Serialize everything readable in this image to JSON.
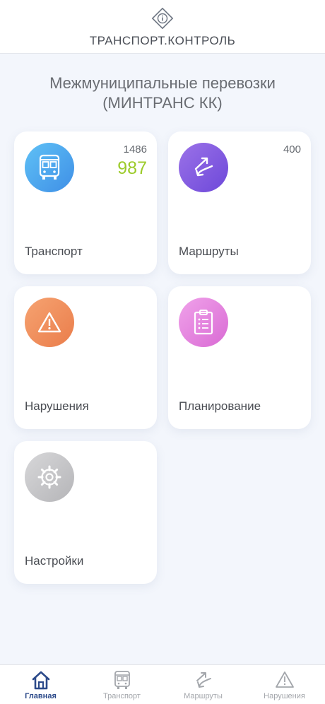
{
  "header": {
    "app_title": "ТРАНСПОРТ.КОНТРОЛЬ",
    "logo_icon": "info-icon"
  },
  "page": {
    "title_line1": "Межмуниципальные перевозки",
    "title_line2": "(МИНТРАНС КК)"
  },
  "tiles": [
    {
      "label": "Транспорт",
      "icon": "bus-icon",
      "color": "#4aa8ef",
      "count_total": "1486",
      "count_active": "987"
    },
    {
      "label": "Маршруты",
      "icon": "route-icon",
      "color": "#7f5ae0",
      "count_total": "400"
    },
    {
      "label": "Нарушения",
      "icon": "warning-icon",
      "color": "#ef8c5a"
    },
    {
      "label": "Планирование",
      "icon": "clipboard-icon",
      "color": "#e07fda"
    },
    {
      "label": "Настройки",
      "icon": "gear-icon",
      "color": "#c4c4c6"
    }
  ],
  "tabbar": {
    "items": [
      {
        "label": "Главная",
        "icon": "home-icon",
        "active": true
      },
      {
        "label": "Транспорт",
        "icon": "bus-icon",
        "active": false
      },
      {
        "label": "Маршруты",
        "icon": "route-icon",
        "active": false
      },
      {
        "label": "Нарушения",
        "icon": "warning-icon",
        "active": false
      }
    ]
  },
  "colors": {
    "accent": "#2c4a8a",
    "active_count": "#9ccb2a",
    "background": "#f3f6fc"
  }
}
